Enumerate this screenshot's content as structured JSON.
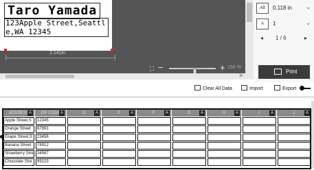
{
  "label": {
    "name": "Taro Yamada",
    "address": "123Apple Street,Seattle,WA 12345",
    "width_text": "2.141in"
  },
  "zoom": {
    "fit_icon": "fit-icon",
    "minus": "−",
    "plus": "+",
    "percent": "150 %",
    "level": 0.55
  },
  "panel": {
    "tape_width": "0.118 in",
    "copies": "1",
    "page": "1 / 6",
    "print_label": "Print"
  },
  "toolbar": {
    "clear_all": "Clear All Data",
    "import": "Import",
    "export": "Export"
  },
  "sheet": {
    "columns": [
      "ADDRESS",
      "ZIP CODE",
      "D",
      "E",
      "F",
      "G",
      "H",
      "I",
      "J"
    ],
    "rows": [
      [
        "Apple Street,S",
        "12345"
      ],
      [
        "Orange Street",
        "67891"
      ],
      [
        "Grape Street,S",
        "23456"
      ],
      [
        "Banana Street",
        "78912"
      ],
      [
        "Strawberry Stre",
        "34567"
      ],
      [
        "Chocolate Stre",
        "89123"
      ]
    ]
  },
  "colors": {
    "editor_bg": "#555555",
    "print_button": "#3c3c3c",
    "header_bg": "#8a8a8a"
  }
}
